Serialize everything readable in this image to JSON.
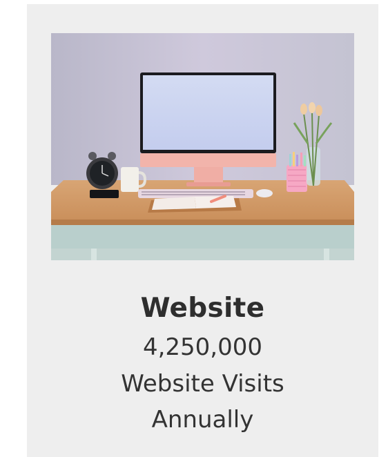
{
  "card": {
    "image": {
      "alt": "Desk with monitor, alarm clock, mug, keyboard, notebook, pen holder and tulips",
      "icon": "workspace-photo"
    },
    "title": "Website",
    "value": "4,250,000",
    "label_line1": "Website Visits",
    "label_line2": "Annually"
  }
}
